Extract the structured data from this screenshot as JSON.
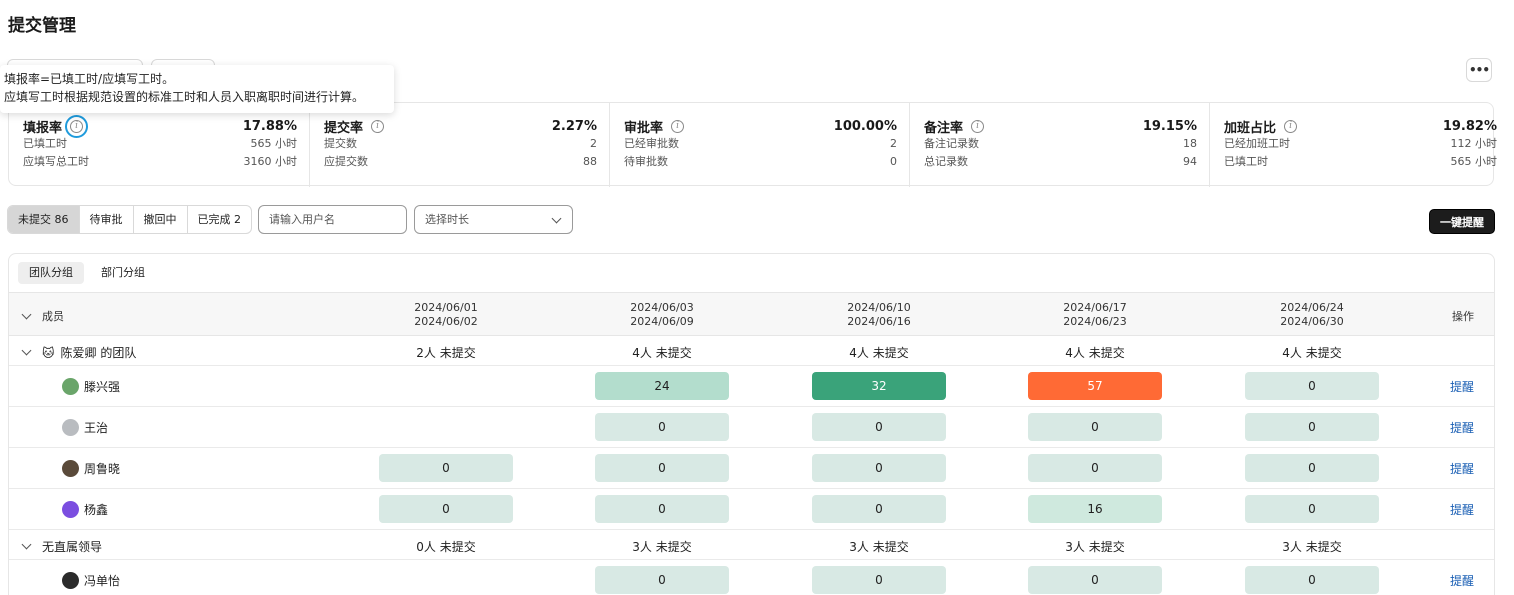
{
  "page_title": "提交管理",
  "tooltip": {
    "line1": "填报率=已填工时/应填写工时。",
    "line2": "应填写工时根据规范设置的标准工时和人员入职离职时间进行计算。"
  },
  "more_icon": "more-horizontal-icon",
  "metrics": [
    {
      "name": "填报率",
      "value": "17.88%",
      "rows": [
        {
          "label": "已填工时",
          "value": "565 小时"
        },
        {
          "label": "应填写总工时",
          "value": "3160 小时"
        }
      ]
    },
    {
      "name": "提交率",
      "value": "2.27%",
      "rows": [
        {
          "label": "提交数",
          "value": "2"
        },
        {
          "label": "应提交数",
          "value": "88"
        }
      ]
    },
    {
      "name": "审批率",
      "value": "100.00%",
      "rows": [
        {
          "label": "已经审批数",
          "value": "2"
        },
        {
          "label": "待审批数",
          "value": "0"
        }
      ]
    },
    {
      "name": "备注率",
      "value": "19.15%",
      "rows": [
        {
          "label": "备注记录数",
          "value": "18"
        },
        {
          "label": "总记录数",
          "value": "94"
        }
      ]
    },
    {
      "name": "加班占比",
      "value": "19.82%",
      "rows": [
        {
          "label": "已经加班工时",
          "value": "112 小时"
        },
        {
          "label": "已填工时",
          "value": "565 小时"
        }
      ]
    }
  ],
  "status_tabs": [
    {
      "label": "未提交 86",
      "active": true
    },
    {
      "label": "待审批",
      "active": false
    },
    {
      "label": "撤回中",
      "active": false
    },
    {
      "label": "已完成 2",
      "active": false
    }
  ],
  "search": {
    "placeholder": "请输入用户名"
  },
  "duration_select": {
    "value": "选择时长"
  },
  "remind_all_label": "一键提醒",
  "group_tabs": [
    {
      "label": "团队分组",
      "active": true
    },
    {
      "label": "部门分组",
      "active": false
    }
  ],
  "table": {
    "member_header": "成员",
    "ops_header": "操作",
    "periods": [
      {
        "start": "2024/06/01",
        "end": "2024/06/02"
      },
      {
        "start": "2024/06/03",
        "end": "2024/06/09"
      },
      {
        "start": "2024/06/10",
        "end": "2024/06/16"
      },
      {
        "start": "2024/06/17",
        "end": "2024/06/23"
      },
      {
        "start": "2024/06/24",
        "end": "2024/06/30"
      }
    ],
    "remind_label": "提醒",
    "groups": [
      {
        "name": "陈爱卿 的团队",
        "emoji": "🐱",
        "summary": [
          "2人 未提交",
          "4人 未提交",
          "4人 未提交",
          "4人 未提交",
          "4人 未提交"
        ],
        "members": [
          {
            "name": "滕兴强",
            "avatar_color": "#6aa56a",
            "cells": [
              null,
              {
                "v": "24",
                "c": "#b3ddcd"
              },
              {
                "v": "32",
                "c": "#3aa37a",
                "light": true
              },
              {
                "v": "57",
                "c": "#ff6a35",
                "light": true
              },
              {
                "v": "0",
                "c": "#d8e9e4"
              }
            ]
          },
          {
            "name": "王治",
            "avatar_color": "#b9bcc0",
            "cells": [
              null,
              {
                "v": "0",
                "c": "#d8e9e4"
              },
              {
                "v": "0",
                "c": "#d8e9e4"
              },
              {
                "v": "0",
                "c": "#d8e9e4"
              },
              {
                "v": "0",
                "c": "#d8e9e4"
              }
            ]
          },
          {
            "name": "周鲁晓",
            "avatar_color": "#5a4a3a",
            "cells": [
              {
                "v": "0",
                "c": "#d8e9e4"
              },
              {
                "v": "0",
                "c": "#d8e9e4"
              },
              {
                "v": "0",
                "c": "#d8e9e4"
              },
              {
                "v": "0",
                "c": "#d8e9e4"
              },
              {
                "v": "0",
                "c": "#d8e9e4"
              }
            ]
          },
          {
            "name": "杨鑫",
            "avatar_color": "#7b4ee0",
            "cells": [
              {
                "v": "0",
                "c": "#d8e9e4"
              },
              {
                "v": "0",
                "c": "#d8e9e4"
              },
              {
                "v": "0",
                "c": "#d8e9e4"
              },
              {
                "v": "16",
                "c": "#cfe9de"
              },
              {
                "v": "0",
                "c": "#d8e9e4"
              }
            ]
          }
        ]
      },
      {
        "name": "无直属领导",
        "emoji": "",
        "summary": [
          "0人 未提交",
          "3人 未提交",
          "3人 未提交",
          "3人 未提交",
          "3人 未提交"
        ],
        "members": [
          {
            "name": "冯单怡",
            "avatar_color": "#2b2b2b",
            "cells": [
              null,
              {
                "v": "0",
                "c": "#d8e9e4"
              },
              {
                "v": "0",
                "c": "#d8e9e4"
              },
              {
                "v": "0",
                "c": "#d8e9e4"
              },
              {
                "v": "0",
                "c": "#d8e9e4"
              }
            ]
          }
        ]
      }
    ]
  },
  "colors": {
    "accent": "#1f9bdc",
    "link": "#1a5fb4",
    "dark_button": "#1c1c1c"
  }
}
